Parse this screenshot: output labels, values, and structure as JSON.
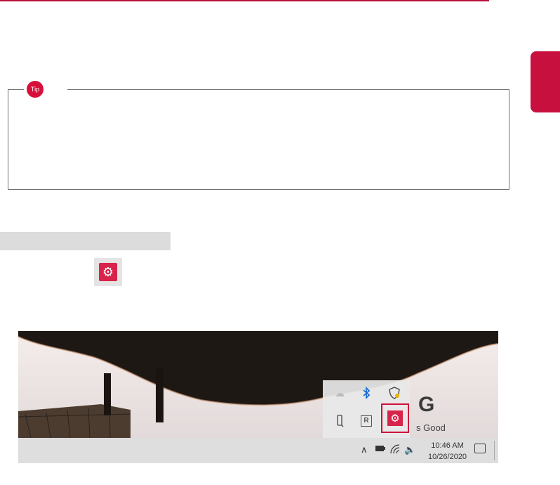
{
  "tip": {
    "badge_label": "Tip"
  },
  "screenshot": {
    "brand_letter": "G",
    "brand_slogan": "s Good",
    "taskbar": {
      "time": "10:46 AM",
      "date": "10/26/2020"
    },
    "tray_icons": [
      "onedrive-icon",
      "bluetooth-icon",
      "defender-icon",
      "usb-icon",
      "realtek-icon",
      "lg-control-center-icon"
    ]
  },
  "colors": {
    "accent": "#c8103f",
    "badge": "#d6103b",
    "highlight_border": "#d0103a"
  }
}
